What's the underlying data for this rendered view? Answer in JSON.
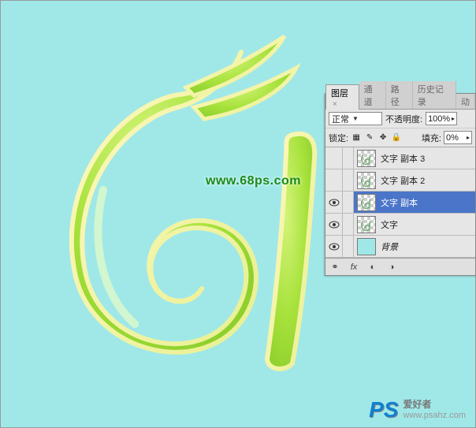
{
  "watermark": {
    "center": "www.68ps.com",
    "brand": "PS",
    "line1": "爱好者",
    "line2": "www.psahz.com"
  },
  "panel": {
    "tabs": {
      "layers": "图层",
      "channels": "通道",
      "paths": "路径",
      "history": "历史记录",
      "actions": "动"
    },
    "blend_mode": "正常",
    "opacity_label": "不透明度:",
    "opacity_value": "100%",
    "lock_label": "锁定:",
    "fill_label": "填充:",
    "fill_value": "0%",
    "layers": [
      {
        "visible": false,
        "name": "文字 副本 3",
        "selected": false,
        "type": "art"
      },
      {
        "visible": false,
        "name": "文字 副本 2",
        "selected": false,
        "type": "art"
      },
      {
        "visible": true,
        "name": "文字 副本",
        "selected": true,
        "type": "art"
      },
      {
        "visible": true,
        "name": "文字",
        "selected": false,
        "type": "art"
      },
      {
        "visible": true,
        "name": "背景",
        "selected": false,
        "type": "bg",
        "italic": true
      }
    ],
    "footer_icons": [
      "link",
      "fx",
      "mask",
      "adjust",
      "group",
      "new",
      "trash"
    ]
  }
}
